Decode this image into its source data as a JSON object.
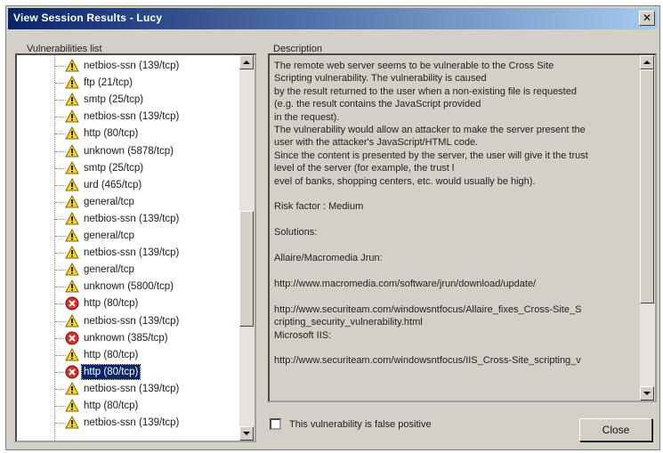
{
  "window": {
    "title": "View Session Results - Lucy"
  },
  "vulnerabilities": {
    "label": "Vulnerabilities list",
    "items": [
      {
        "icon": "warning",
        "label": "netbios-ssn (139/tcp)"
      },
      {
        "icon": "warning",
        "label": "ftp (21/tcp)"
      },
      {
        "icon": "warning",
        "label": "smtp (25/tcp)"
      },
      {
        "icon": "warning",
        "label": "netbios-ssn (139/tcp)"
      },
      {
        "icon": "warning",
        "label": "http (80/tcp)"
      },
      {
        "icon": "warning",
        "label": "unknown (5878/tcp)"
      },
      {
        "icon": "warning",
        "label": "smtp (25/tcp)"
      },
      {
        "icon": "warning",
        "label": "urd (465/tcp)"
      },
      {
        "icon": "warning",
        "label": "general/tcp"
      },
      {
        "icon": "warning",
        "label": "netbios-ssn (139/tcp)"
      },
      {
        "icon": "warning",
        "label": "general/tcp"
      },
      {
        "icon": "warning",
        "label": "netbios-ssn (139/tcp)"
      },
      {
        "icon": "warning",
        "label": "general/tcp"
      },
      {
        "icon": "warning",
        "label": "unknown (5800/tcp)"
      },
      {
        "icon": "error",
        "label": "http (80/tcp)"
      },
      {
        "icon": "warning",
        "label": "netbios-ssn (139/tcp)"
      },
      {
        "icon": "error",
        "label": "unknown (385/tcp)"
      },
      {
        "icon": "warning",
        "label": "http (80/tcp)"
      },
      {
        "icon": "error",
        "label": "http (80/tcp)",
        "selected": true
      },
      {
        "icon": "warning",
        "label": "netbios-ssn (139/tcp)"
      },
      {
        "icon": "warning",
        "label": "http (80/tcp)"
      },
      {
        "icon": "warning",
        "label": "netbios-ssn (139/tcp)"
      }
    ]
  },
  "description": {
    "label": "Description",
    "text": "The remote web server seems to be vulnerable to the Cross Site\nScripting vulnerability. The vulnerability is caused\nby the result returned to the user when a non-existing file is requested\n(e.g. the result contains the JavaScript provided\nin the request).\nThe vulnerability would allow an attacker to make the server present the\nuser with the attacker's JavaScript/HTML code.\nSince the content is presented by the server, the user will give it the trust\nlevel of the server (for example, the trust l\nevel of banks, shopping centers, etc. would usually be high).\n\nRisk factor : Medium\n\nSolutions:\n\nAllaire/Macromedia Jrun:\n\nhttp://www.macromedia.com/software/jrun/download/update/\n\nhttp://www.securiteam.com/windowsntfocus/Allaire_fixes_Cross-Site_S\ncripting_security_vulnerability.html\nMicrosoft IIS:\n\nhttp://www.securiteam.com/windowsntfocus/IIS_Cross-Site_scripting_v"
  },
  "false_positive": {
    "label": "This vulnerability is false positive"
  },
  "close_button": {
    "label": "Close"
  }
}
